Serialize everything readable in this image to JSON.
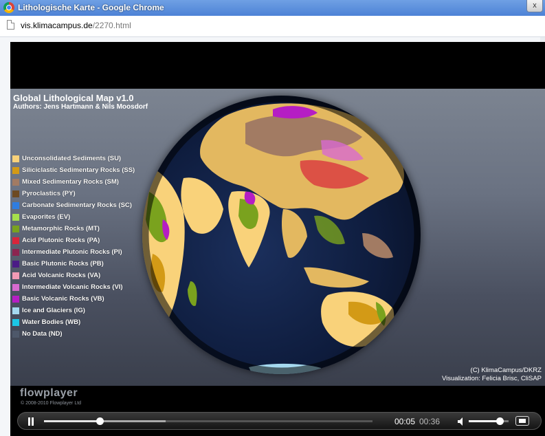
{
  "window": {
    "title": "Lithologische Karte - Google Chrome",
    "close_label": "x"
  },
  "address": {
    "domain": "vis.klimacampus.de",
    "path": "/2270.html"
  },
  "video": {
    "map_title": "Global Lithological Map v1.0",
    "authors": "Authors: Jens Hartmann & Nils Moosdorf",
    "legend": [
      {
        "label": "Unconsolidated Sediments (SU)",
        "color": "#f9d27a"
      },
      {
        "label": "Siliciclastic Sedimentary Rocks (SS)",
        "color": "#d39a16"
      },
      {
        "label": "Mixed Sedimentary Rocks (SM)",
        "color": "#a27b63"
      },
      {
        "label": "Pyroclastics (PY)",
        "color": "#6d4a22"
      },
      {
        "label": "Carbonate Sedimentary Rocks (SC)",
        "color": "#2f7de0"
      },
      {
        "label": "Evaporites (EV)",
        "color": "#a6df4c"
      },
      {
        "label": "Metamorphic Rocks (MT)",
        "color": "#7aa21e"
      },
      {
        "label": "Acid Plutonic Rocks (PA)",
        "color": "#d8253b"
      },
      {
        "label": "Intermediate Plutonic Rocks (PI)",
        "color": "#8c2450"
      },
      {
        "label": "Basic Plutonic Rocks (PB)",
        "color": "#4b1b86"
      },
      {
        "label": "Acid Volcanic Rocks (VA)",
        "color": "#f29ab5"
      },
      {
        "label": "Intermediate Volcanic Rocks (VI)",
        "color": "#d86ad0"
      },
      {
        "label": "Basic Volcanic Rocks (VB)",
        "color": "#b51ec4"
      },
      {
        "label": "Ice and Glaciers (IG)",
        "color": "#a5d9ef"
      },
      {
        "label": "Water Bodies (WB)",
        "color": "#1cc7e6"
      },
      {
        "label": "No Data (ND)",
        "color": "#4e586a"
      }
    ],
    "copyright_credit": "(C) KlimaCampus/DKRZ",
    "visualization_credit": "Visualization: Felicia Brisc, CliSAP"
  },
  "player": {
    "brand": "flowplayer",
    "brand_copyright": "© 2008-2010 Flowplayer Ltd",
    "time_current": "00:05",
    "time_total": "00:36",
    "progress": 0.17,
    "buffered": 0.37,
    "volume": 0.78
  }
}
